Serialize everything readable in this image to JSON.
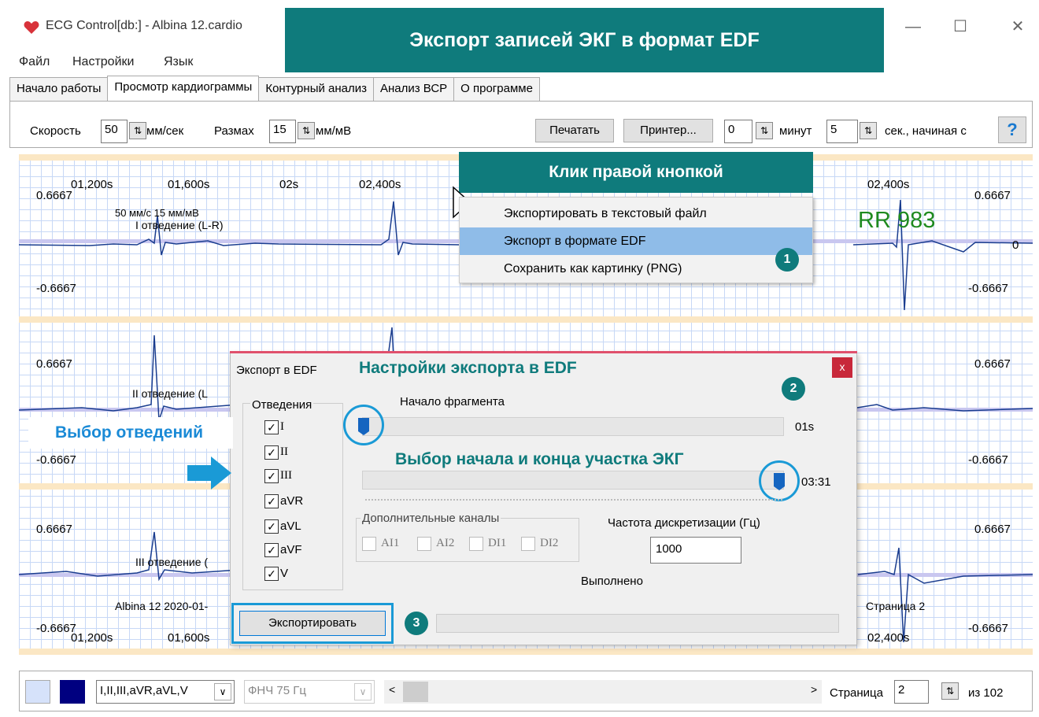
{
  "window": {
    "title": "ECG Control[db:] - Albina 12.cardio",
    "controls": {
      "minimize": "—",
      "maximize": "☐",
      "close": "✕"
    }
  },
  "banner": {
    "main": "Экспорт записей ЭКГ в формат EDF"
  },
  "menu": [
    "Файл",
    "Настройки",
    "Язык"
  ],
  "tabs": [
    "Начало работы",
    "Просмотр кардиограммы",
    "Контурный анализ",
    "Анализ ВСР",
    "О программе"
  ],
  "toolbar": {
    "speed_label": "Скорость",
    "speed_value": "50",
    "speed_unit": "мм/сек",
    "amp_label": "Размах",
    "amp_value": "15",
    "amp_unit": "мм/мВ",
    "print": "Печатать",
    "printer": "Принтер...",
    "minutes_value": "0",
    "minutes_label": "минут",
    "seconds_value": "5",
    "seconds_label": "сек., начиная с",
    "help": "?"
  },
  "ecg": {
    "times_top": [
      "01,200s",
      "01,600s",
      "02s",
      "02,400s",
      "02,400s"
    ],
    "times_bottom": [
      "01,200s",
      "01,600s",
      "02,400s"
    ],
    "pos": "0.6667",
    "neg": "-0.6667",
    "zero": "0",
    "scale_note": "50 мм/с  15 мм/мВ",
    "lead1": "I отведение (L-R)",
    "lead2": "II отведение (L",
    "lead3": "III отведение (",
    "rr": "RR 983",
    "patient": "Albina 12 2020-01-",
    "page_label": "Страница 2"
  },
  "context_menu": {
    "header": "Клик правой кнопкой",
    "items": [
      "Экспортировать в текстовый файл",
      "Экспорт в формате EDF",
      "Сохранить как картинку (PNG)"
    ],
    "badge": "1"
  },
  "dialog": {
    "title": "Экспорт в EDF",
    "heading": "Настройки экспорта в EDF",
    "close": "x",
    "badge2": "2",
    "leads_group": "Отведения",
    "leads": [
      "I",
      "II",
      "III",
      "aVR",
      "aVL",
      "aVF",
      "V"
    ],
    "leads_annotation": "Выбор отведений",
    "start_label": "Начало фрагмента",
    "start_value": "01s",
    "range_annotation": "Выбор начала и конца участка ЭКГ",
    "end_value": "03:31",
    "extra_group": "Дополнительные каналы",
    "extra": [
      "AI1",
      "AI2",
      "DI1",
      "DI2"
    ],
    "freq_label": "Частота дискретизации (Гц)",
    "freq_value": "1000",
    "status": "Выполнено",
    "export_button": "Экспортировать",
    "badge3": "3"
  },
  "statusbar": {
    "leads_combo": "I,II,III,aVR,aVL,V",
    "filter_combo": "ФНЧ 75 Гц",
    "page_label": "Страница",
    "page_value": "2",
    "page_total": "из 102"
  },
  "colors": {
    "teal": "#0f7b7c",
    "accent_blue": "#1a9ad6",
    "selection": "#8fbce8",
    "color_swatch_light": "#d6e2fa",
    "color_swatch_dark": "#000080"
  }
}
